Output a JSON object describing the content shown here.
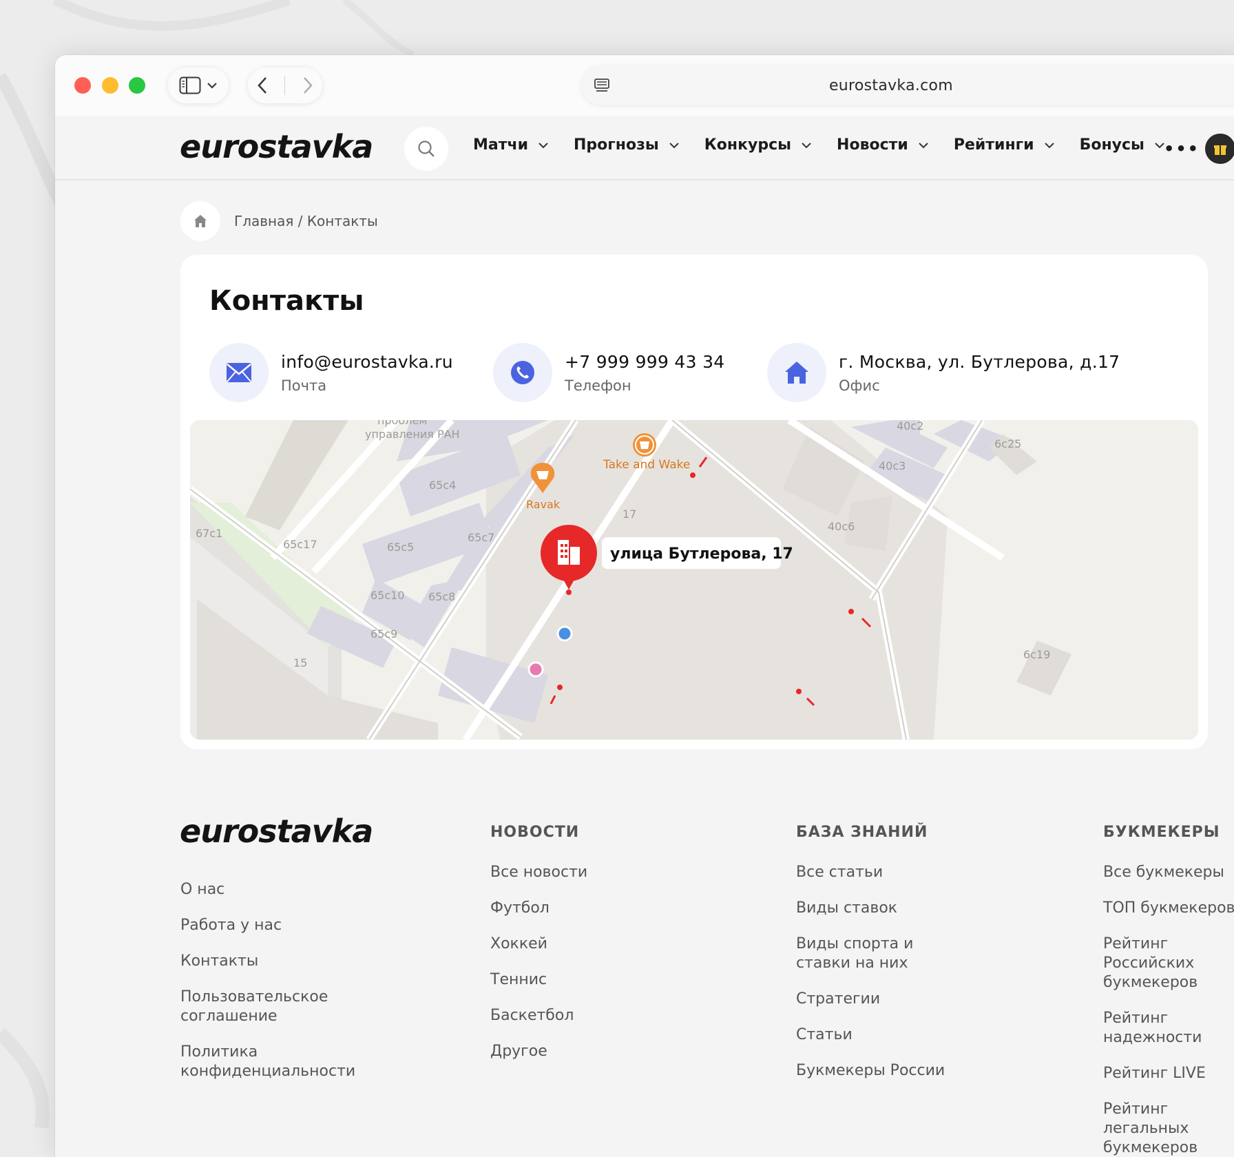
{
  "browser": {
    "url": "eurostavka.com"
  },
  "header": {
    "logo": "eurostavka",
    "menu": [
      "Матчи",
      "Прогнозы",
      "Конкурсы",
      "Новости",
      "Рейтинги",
      "Бонусы"
    ],
    "more": "•••"
  },
  "breadcrumb": "Главная / Контакты",
  "contacts": {
    "title": "Контакты",
    "items": [
      {
        "value": "info@eurostavka.ru",
        "label": "Почта",
        "icon": "mail-icon"
      },
      {
        "value": "+7 999 999 43 34",
        "label": "Телефон",
        "icon": "phone-icon"
      },
      {
        "value": "г. Москва, ул. Бутлерова, д.17",
        "label": "Офис",
        "icon": "home-icon"
      }
    ]
  },
  "map": {
    "pin_label": "улица Бутлерова, 17",
    "pois": [
      "Take and Wake",
      "Ravak"
    ],
    "labels": [
      "проблем",
      "управления РАН",
      "65с4",
      "40с2",
      "40с3",
      "6с25",
      "17",
      "40с6",
      "67с1",
      "65с17",
      "65с5",
      "65с7",
      "65с10",
      "65с8",
      "65с9",
      "15",
      "6с19"
    ]
  },
  "footer": {
    "logo": "eurostavka",
    "about": [
      "О нас",
      "Работа у нас",
      "Контакты",
      "Пользовательское соглашение",
      "Политика конфиденциальности"
    ],
    "news": {
      "title": "НОВОСТИ",
      "links": [
        "Все новости",
        "Футбол",
        "Хоккей",
        "Теннис",
        "Баскетбол",
        "Другое"
      ]
    },
    "knowledge": {
      "title": "БАЗА ЗНАНИЙ",
      "links": [
        "Все статьи",
        "Виды ставок",
        "Виды спорта и ставки на них",
        "Стратегии",
        "Статьи",
        "Букмекеры России"
      ]
    },
    "bookmakers": {
      "title": "БУКМЕКЕРЫ",
      "links": [
        "Все букмекеры",
        "ТОП букмекеров",
        "Рейтинг Российских букмекеров",
        "Рейтинг надежности",
        "Рейтинг LIVE",
        "Рейтинг легальных букмекеров"
      ]
    }
  },
  "colors": {
    "accent": "#4a63e0",
    "pin": "#e62828",
    "poi": "#f0923a"
  }
}
